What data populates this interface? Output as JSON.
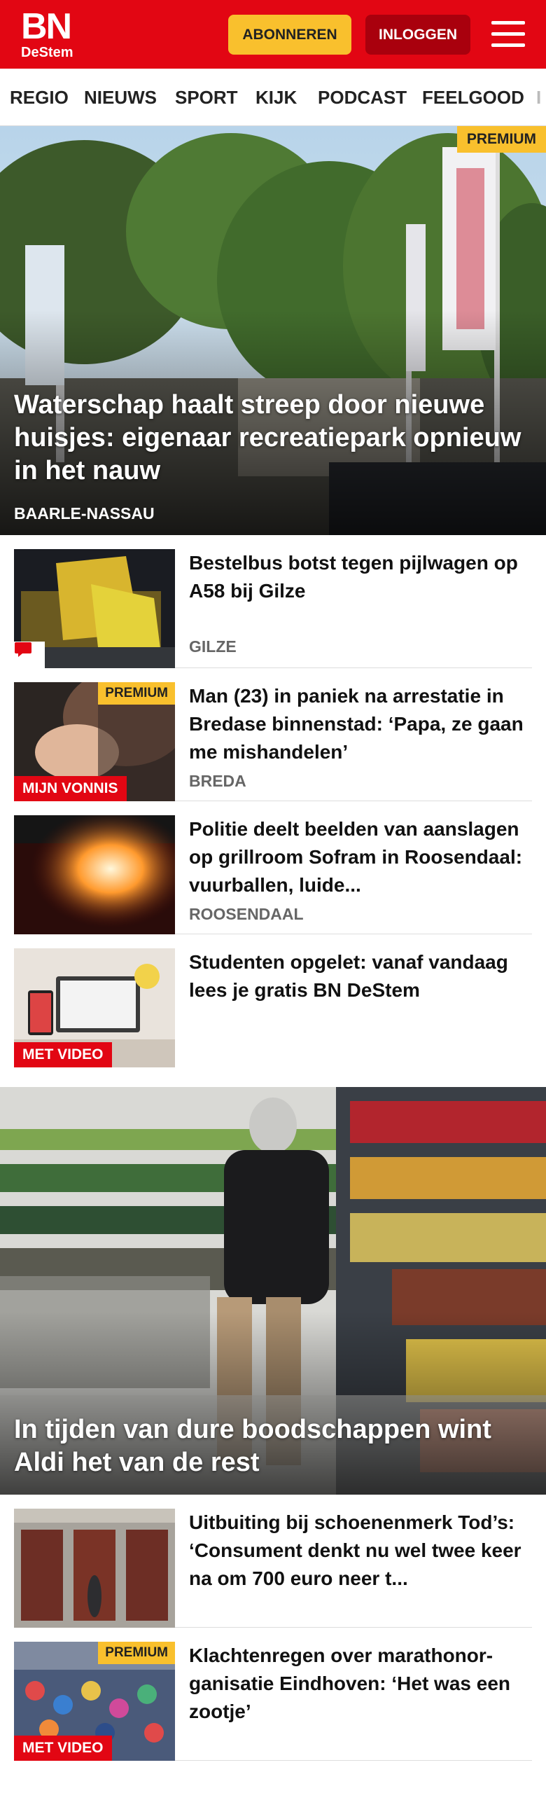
{
  "header": {
    "logo_main": "BN",
    "logo_sub": "DeStem",
    "subscribe_label": "ABONNEREN",
    "login_label": "INLOGGEN",
    "menu_icon": "hamburger-icon",
    "colors": {
      "brand_red": "#e20613",
      "dark_red": "#a9000d",
      "accent_yellow": "#f9c02d"
    }
  },
  "nav": {
    "items": [
      "REGIO",
      "NIEUWS",
      "SPORT",
      "KIJK",
      "PODCAST",
      "FEELGOOD",
      "I"
    ]
  },
  "hero": {
    "badge": "PREMIUM",
    "title": "Waterschap haalt streep door nieuwe huisjes: eigenaar recreatiepark opnieuw in het nauw",
    "location": "BAARLE-NASSAU"
  },
  "articles": [
    {
      "title": "Bestelbus botst tegen pijlwagen op A58 bij Gilze",
      "location": "GILZE",
      "comment_icon": "comment-icon"
    },
    {
      "title": "Man (23) in paniek na arrestatie in Bredase binnenstad: ‘Papa, ze gaan me mishandelen’",
      "location": "BREDA",
      "badge": "MIJN VONNIS",
      "premium": "PREMIUM"
    },
    {
      "title": "Politie deelt beelden van aanslagen op grillroom Sofram in Roosendaal: vuurballen, luide...",
      "location": "ROOSENDAAL"
    },
    {
      "title": "Studenten opgelet: vanaf vandaag lees je gratis BN DeStem",
      "badge": "MET VIDEO"
    }
  ],
  "feature": {
    "title": "In tijden van dure boodschappen wint Aldi het van de rest"
  },
  "articles2": [
    {
      "title": "Uitbuiting bij schoenenmerk Tod’s: ‘Consument denkt nu wel twee keer na om 700 euro neer t..."
    },
    {
      "title": "Klachtenregen over marathonor­ganisatie Eindhoven: ‘Het was een zootje’",
      "badge": "MET VIDEO",
      "premium": "PREMIUM"
    }
  ]
}
